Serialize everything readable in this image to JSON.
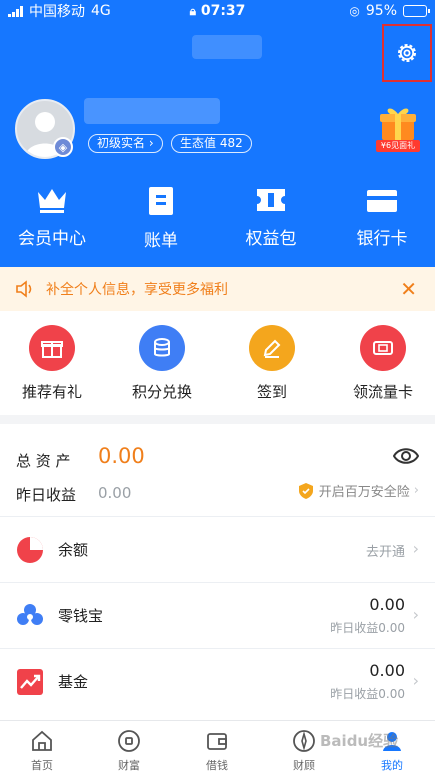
{
  "status_bar": {
    "carrier": "中国移动",
    "network": "4G",
    "time": "07:37",
    "battery": "95%"
  },
  "profile": {
    "verify_label": "初级实名",
    "eco_label": "生态值 482",
    "gift_label": "¥6见面礼"
  },
  "quick_links": [
    {
      "label": "会员中心",
      "icon": "crown-icon"
    },
    {
      "label": "账单",
      "icon": "bill-icon"
    },
    {
      "label": "权益包",
      "icon": "ticket-icon"
    },
    {
      "label": "银行卡",
      "icon": "card-icon"
    }
  ],
  "notice": {
    "text": "补全个人信息，享受更多福利"
  },
  "actions": [
    {
      "label": "推荐有礼",
      "color": "#f0424a",
      "icon": "gift-icon"
    },
    {
      "label": "积分兑换",
      "color": "#3f7ef5",
      "icon": "database-icon"
    },
    {
      "label": "签到",
      "color": "#f4a61d",
      "icon": "pencil-icon"
    },
    {
      "label": "领流量卡",
      "color": "#f0424a",
      "icon": "sim-card-icon"
    }
  ],
  "assets": {
    "total_label": "总 资 产",
    "total_value": "0.00",
    "yesterday_label": "昨日收益",
    "yesterday_value": "0.00",
    "insurance_text": "开启百万安全险",
    "items": [
      {
        "name": "余额",
        "right_text": "去开通",
        "icon": "pie-icon"
      },
      {
        "name": "零钱宝",
        "amount": "0.00",
        "sub": "昨日收益0.00",
        "icon": "clover-icon"
      },
      {
        "name": "基金",
        "amount": "0.00",
        "sub": "昨日收益0.00",
        "icon": "fund-icon"
      }
    ]
  },
  "tabs": [
    {
      "label": "首页",
      "icon": "home-icon"
    },
    {
      "label": "财富",
      "icon": "wealth-icon"
    },
    {
      "label": "借钱",
      "icon": "wallet-icon"
    },
    {
      "label": "财顾",
      "icon": "advisor-icon"
    },
    {
      "label": "我的",
      "icon": "profile-icon",
      "active": true
    }
  ],
  "colors": {
    "brand_blue": "#1677ff",
    "orange": "#f07f1b",
    "red": "#f0424a"
  },
  "watermark": "Baidu经验"
}
